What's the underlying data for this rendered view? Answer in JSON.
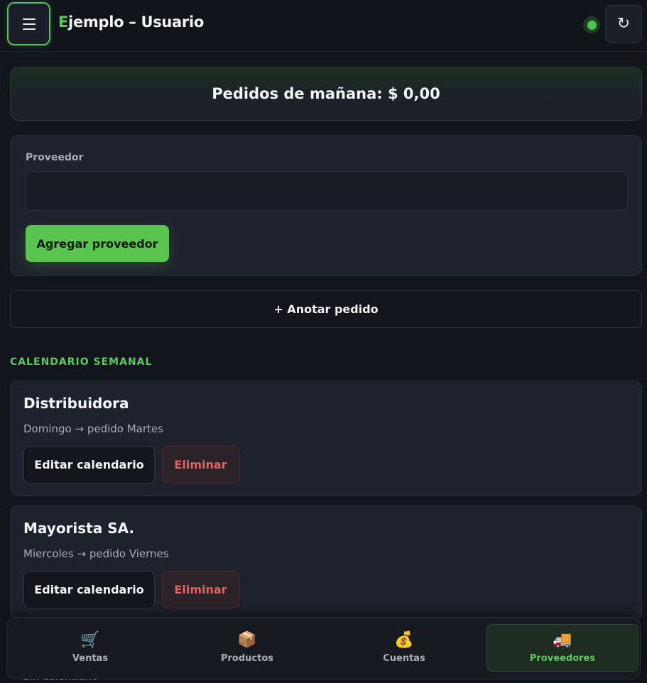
{
  "header": {
    "title_first_letter": "E",
    "title_rest": "jemplo – Usuario",
    "refresh_glyph": "↻"
  },
  "summary": {
    "text": "Pedidos de mañana: $ 0,00"
  },
  "form": {
    "label": "Proveedor",
    "input_value": "",
    "input_placeholder": "",
    "add_label": "Agregar proveedor"
  },
  "note_button": "+ Anotar pedido",
  "section_title": "CALENDARIO SEMANAL",
  "providers": [
    {
      "name": "Distribuidora",
      "schedule": "Domingo → pedido Martes",
      "edit_label": "Editar calendario",
      "delete_label": "Eliminar"
    },
    {
      "name": "Mayorista SA.",
      "schedule": "Miercoles → pedido Viernes",
      "edit_label": "Editar calendario",
      "delete_label": "Eliminar"
    }
  ],
  "partial_text": "Sin calendario",
  "nav": [
    {
      "label": "Ventas",
      "icon": "cart-icon",
      "glyph": "🛒",
      "active": false
    },
    {
      "label": "Productos",
      "icon": "package-icon",
      "glyph": "📦",
      "active": false
    },
    {
      "label": "Cuentas",
      "icon": "money-bag-icon",
      "glyph": "💰",
      "active": false
    },
    {
      "label": "Proveedores",
      "icon": "truck-icon",
      "glyph": "🚚",
      "active": true
    }
  ],
  "colors": {
    "accent": "#5cc95e",
    "danger": "#e46161",
    "background": "#12151c",
    "card": "#1e222c"
  }
}
